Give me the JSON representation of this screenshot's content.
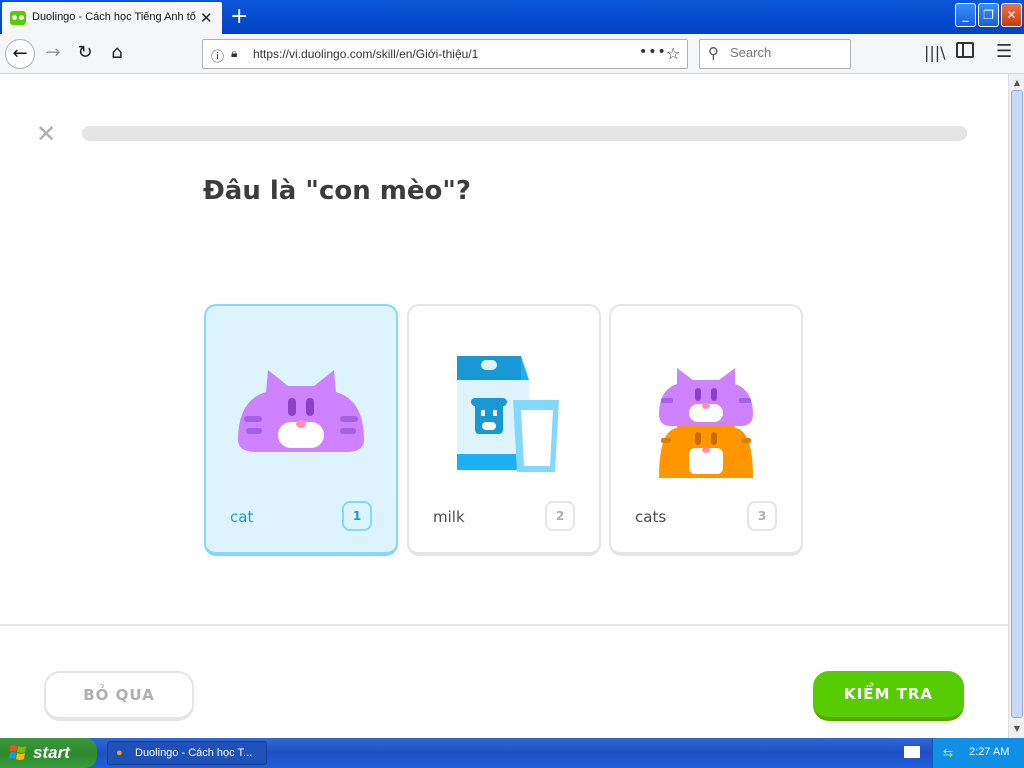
{
  "browser": {
    "tab_title": "Duolingo - Cách học Tiếng Anh tốt",
    "url": "https://vi.duolingo.com/skill/en/Giới-thiệu/1",
    "search_placeholder": "Search"
  },
  "lesson": {
    "progress": 0,
    "question": "Đâu là \"con mèo\"?",
    "choices": [
      {
        "label": "cat",
        "key": "1",
        "image": "cat-icon",
        "selected": true
      },
      {
        "label": "milk",
        "key": "2",
        "image": "milk-icon",
        "selected": false
      },
      {
        "label": "cats",
        "key": "3",
        "image": "cats-icon",
        "selected": false
      }
    ],
    "skip_label": "BỎ QUA",
    "check_label": "KIỂM TRA"
  },
  "colors": {
    "brand_green": "#58cc02",
    "selected_bg": "#ddf4ff",
    "selected_border": "#84d8ff",
    "cat_purple": "#ce82ff",
    "cat_orange": "#ff9600",
    "milk_blue": "#1cb0f6"
  },
  "taskbar": {
    "start_label": "start",
    "task_label": "Duolingo - Cách học T...",
    "clock": "2:27 AM"
  }
}
